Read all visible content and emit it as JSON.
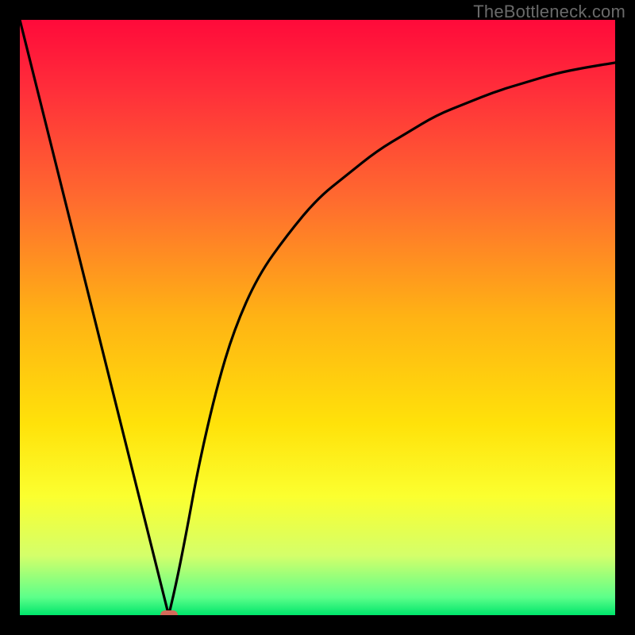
{
  "watermark": "TheBottleneck.com",
  "chart_data": {
    "type": "line",
    "title": "",
    "xlabel": "",
    "ylabel": "",
    "xlim": [
      0,
      100
    ],
    "ylim": [
      0,
      100
    ],
    "grid": false,
    "legend": false,
    "gradient_stops": [
      {
        "pct": 0,
        "color": "#ff0a3a"
      },
      {
        "pct": 12,
        "color": "#ff2f3a"
      },
      {
        "pct": 30,
        "color": "#ff6a2f"
      },
      {
        "pct": 50,
        "color": "#ffb314"
      },
      {
        "pct": 68,
        "color": "#ffe20a"
      },
      {
        "pct": 80,
        "color": "#fbff2f"
      },
      {
        "pct": 90,
        "color": "#d4ff6a"
      },
      {
        "pct": 97,
        "color": "#5cff8a"
      },
      {
        "pct": 100,
        "color": "#00e56b"
      }
    ],
    "series": [
      {
        "name": "bottleneck-curve",
        "x": [
          0,
          5,
          10,
          15,
          20,
          22,
          24,
          25,
          26,
          28,
          30,
          33,
          36,
          40,
          45,
          50,
          55,
          60,
          65,
          70,
          75,
          80,
          85,
          90,
          95,
          100
        ],
        "y": [
          100,
          80,
          60,
          40,
          20,
          12,
          4,
          0,
          4,
          14,
          25,
          38,
          48,
          57,
          64,
          70,
          74,
          78,
          81,
          84,
          86,
          88,
          89.5,
          91,
          92,
          92.8
        ]
      }
    ],
    "marker": {
      "name": "optimal-point",
      "x": 25,
      "y": 0,
      "color": "#d46a5a"
    }
  }
}
